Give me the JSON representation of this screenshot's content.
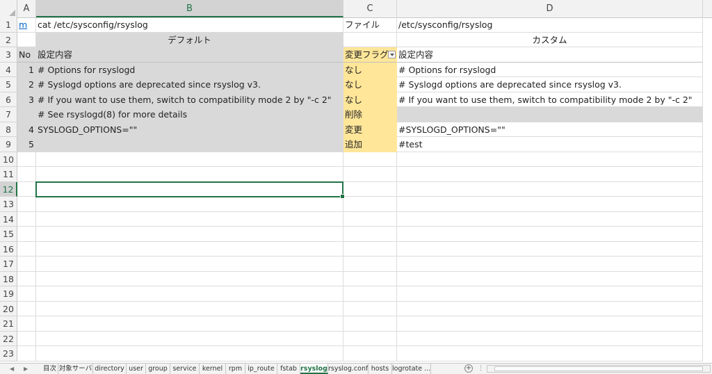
{
  "columns": [
    "A",
    "B",
    "C",
    "D"
  ],
  "rows": [
    "1",
    "2",
    "3",
    "4",
    "5",
    "6",
    "7",
    "8",
    "9",
    "10",
    "11",
    "12",
    "13",
    "14",
    "15",
    "16",
    "17",
    "18",
    "19",
    "20",
    "21",
    "22",
    "23"
  ],
  "cells": {
    "a1": "m",
    "b1": "cat /etc/sysconfig/rsyslog",
    "c1": "ファイル",
    "d1": "/etc/sysconfig/rsyslog",
    "b2": "デフォルト",
    "d2": "カスタム",
    "a3": "No",
    "b3": "設定内容",
    "c3": "変更フラグ",
    "d3": "設定内容"
  },
  "data_rows": [
    {
      "no": "1",
      "default": "# Options for rsyslogd",
      "flag": "なし",
      "custom": "# Options for rsyslogd"
    },
    {
      "no": "2",
      "default": "# Syslogd options are deprecated since rsyslog v3.",
      "flag": "なし",
      "custom": "# Syslogd options are deprecated since rsyslog v3."
    },
    {
      "no": "3",
      "default": "# If you want to use them, switch to compatibility mode 2 by \"-c 2\"",
      "flag": "なし",
      "custom": "# If you want to use them, switch to compatibility mode 2 by \"-c 2\""
    },
    {
      "no": "",
      "default": "# See rsyslogd(8) for more details",
      "flag": "削除",
      "custom": ""
    },
    {
      "no": "4",
      "default": "SYSLOGD_OPTIONS=\"\"",
      "flag": "変更",
      "custom": "#SYSLOGD_OPTIONS=\"\""
    },
    {
      "no": "5",
      "default": "",
      "flag": "追加",
      "custom": "#test"
    }
  ],
  "sheet_tabs": [
    "目次",
    "対象サーバ",
    "directory",
    "user",
    "group",
    "service",
    "kernel",
    "rpm",
    "ip_route",
    "fstab",
    "rsyslog",
    "rsyslog.conf",
    "hosts",
    "logrotate ..."
  ],
  "active_tab": "rsyslog",
  "selected_cell": "B12",
  "colors": {
    "accent": "#217346",
    "gray_fill": "#d9d9d9",
    "yellow_fill": "#ffe699",
    "link": "#0563c1"
  }
}
